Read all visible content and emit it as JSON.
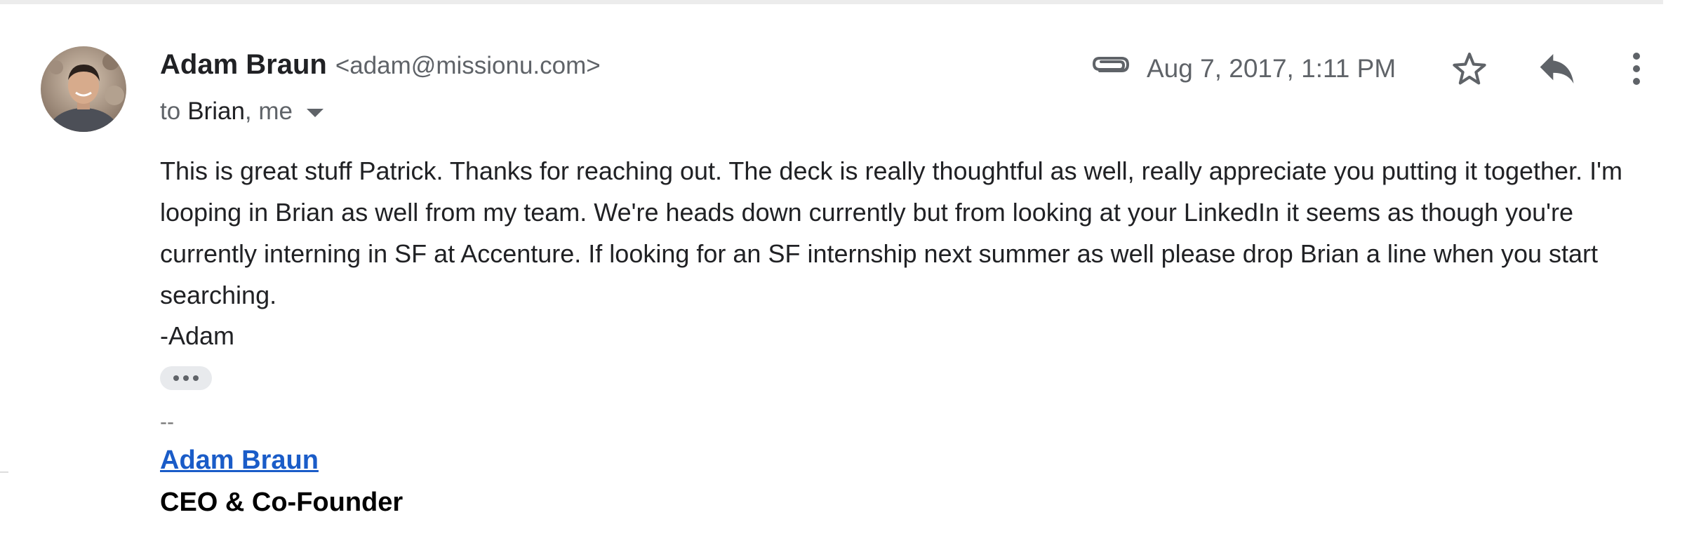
{
  "message": {
    "sender_name": "Adam Braun",
    "sender_email": "<adam@missionu.com>",
    "recipients": {
      "to_label": "to",
      "first": "Brian",
      "rest": ", me"
    },
    "date": "Aug 7, 2017, 1:11 PM",
    "body": "This is great stuff Patrick. Thanks for reaching out. The deck is really thoughtful as well, really appreciate you putting it together. I'm looping in Brian as well from my team. We're heads down currently but from looking at your LinkedIn it seems as though you're currently interning in SF at Accenture. If looking for an SF internship next summer as well please drop Brian a line when you start searching.",
    "signoff": "-Adam",
    "signature": {
      "separator": "--",
      "name_link": "Adam Braun",
      "title": "CEO & Co-Founder"
    }
  },
  "icons": {
    "attachment": "paperclip-icon",
    "star": "star-outline-icon",
    "reply": "reply-icon",
    "more": "more-vertical-icon",
    "expand_recipients": "chevron-down-icon",
    "trimmed_content": "ellipsis-icon"
  },
  "colors": {
    "link": "#1a5cc8",
    "secondary_text": "#5f6368",
    "primary_text": "#202124"
  }
}
